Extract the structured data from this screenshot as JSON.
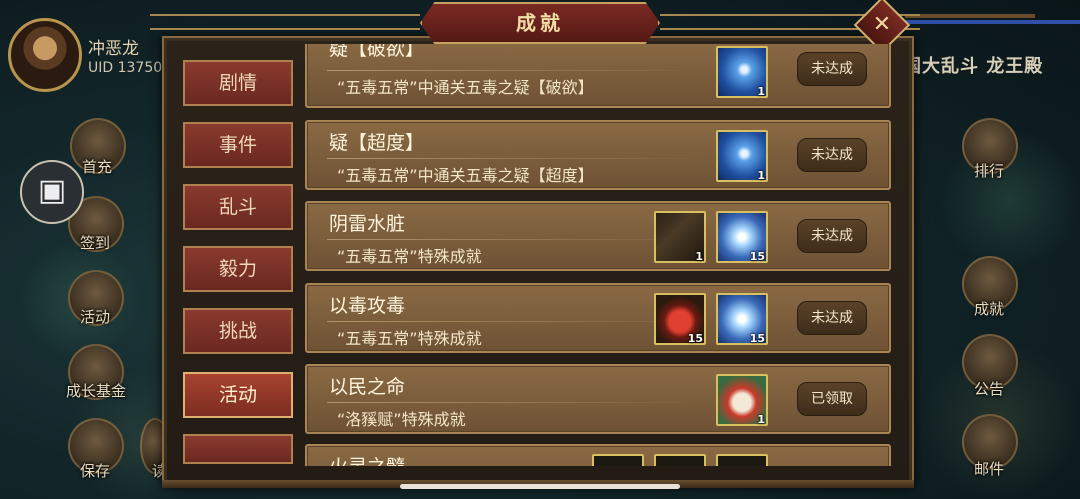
{
  "window_title": "成就",
  "player": {
    "name": "冲恶龙",
    "uid": "UID  13750"
  },
  "top_right_text": "国大乱斗 龙王殿",
  "side_left": [
    {
      "label": "首充",
      "icon": "first-charge-icon"
    },
    {
      "label": "签到",
      "icon": "sign-in-icon"
    },
    {
      "label": "活动",
      "icon": "activity-icon"
    },
    {
      "label": "成长基金",
      "icon": "growth-fund-icon"
    },
    {
      "label": "保存",
      "icon": "save-icon"
    },
    {
      "label": "读",
      "icon": "read-icon"
    }
  ],
  "side_right": [
    {
      "label": "排行",
      "icon": "ranking-icon"
    },
    {
      "label": "成就",
      "icon": "achievement-icon"
    },
    {
      "label": "公告",
      "icon": "notice-icon"
    },
    {
      "label": "邮件",
      "icon": "mail-icon"
    }
  ],
  "tabs": [
    {
      "label": "剧情",
      "active": false
    },
    {
      "label": "事件",
      "active": false
    },
    {
      "label": "乱斗",
      "active": false
    },
    {
      "label": "毅力",
      "active": false
    },
    {
      "label": "挑战",
      "active": false
    },
    {
      "label": "活动",
      "active": true
    }
  ],
  "achievements": [
    {
      "title": "疑【破欲】",
      "desc": "“五毒五常”中通关五毒之疑【破欲】",
      "rewards": [
        {
          "icon": "lightning-item-icon",
          "qty": "1"
        }
      ],
      "status": "未达成"
    },
    {
      "title": "疑【超度】",
      "desc": "“五毒五常”中通关五毒之疑【超度】",
      "rewards": [
        {
          "icon": "lightning-item-icon",
          "qty": "1"
        }
      ],
      "status": "未达成"
    },
    {
      "title": "阴雷水脏",
      "desc": "“五毒五常”特殊成就",
      "rewards": [
        {
          "icon": "bow-item-icon",
          "qty": "1"
        },
        {
          "icon": "ice-crystal-item-icon",
          "qty": "15"
        }
      ],
      "status": "未达成"
    },
    {
      "title": "以毒攻毒",
      "desc": "“五毒五常”特殊成就",
      "rewards": [
        {
          "icon": "fruit-item-icon",
          "qty": "15"
        },
        {
          "icon": "ice-crystal-item-icon",
          "qty": "15"
        }
      ],
      "status": "未达成"
    },
    {
      "title": "以民之命",
      "desc": "“洛豯赋”特殊成就",
      "rewards": [
        {
          "icon": "lion-dance-item-icon",
          "qty": "1"
        }
      ],
      "status": "已领取"
    },
    {
      "title": "火灵之髓",
      "desc": "",
      "rewards": [],
      "status": ""
    }
  ],
  "colors": {
    "panel_border": "#8a6a3c",
    "tab_red": "#8a3a2e",
    "row_brown": "#7a5c3c",
    "title_red": "#6a221b",
    "scroll_thumb": "#e8e2d8"
  }
}
